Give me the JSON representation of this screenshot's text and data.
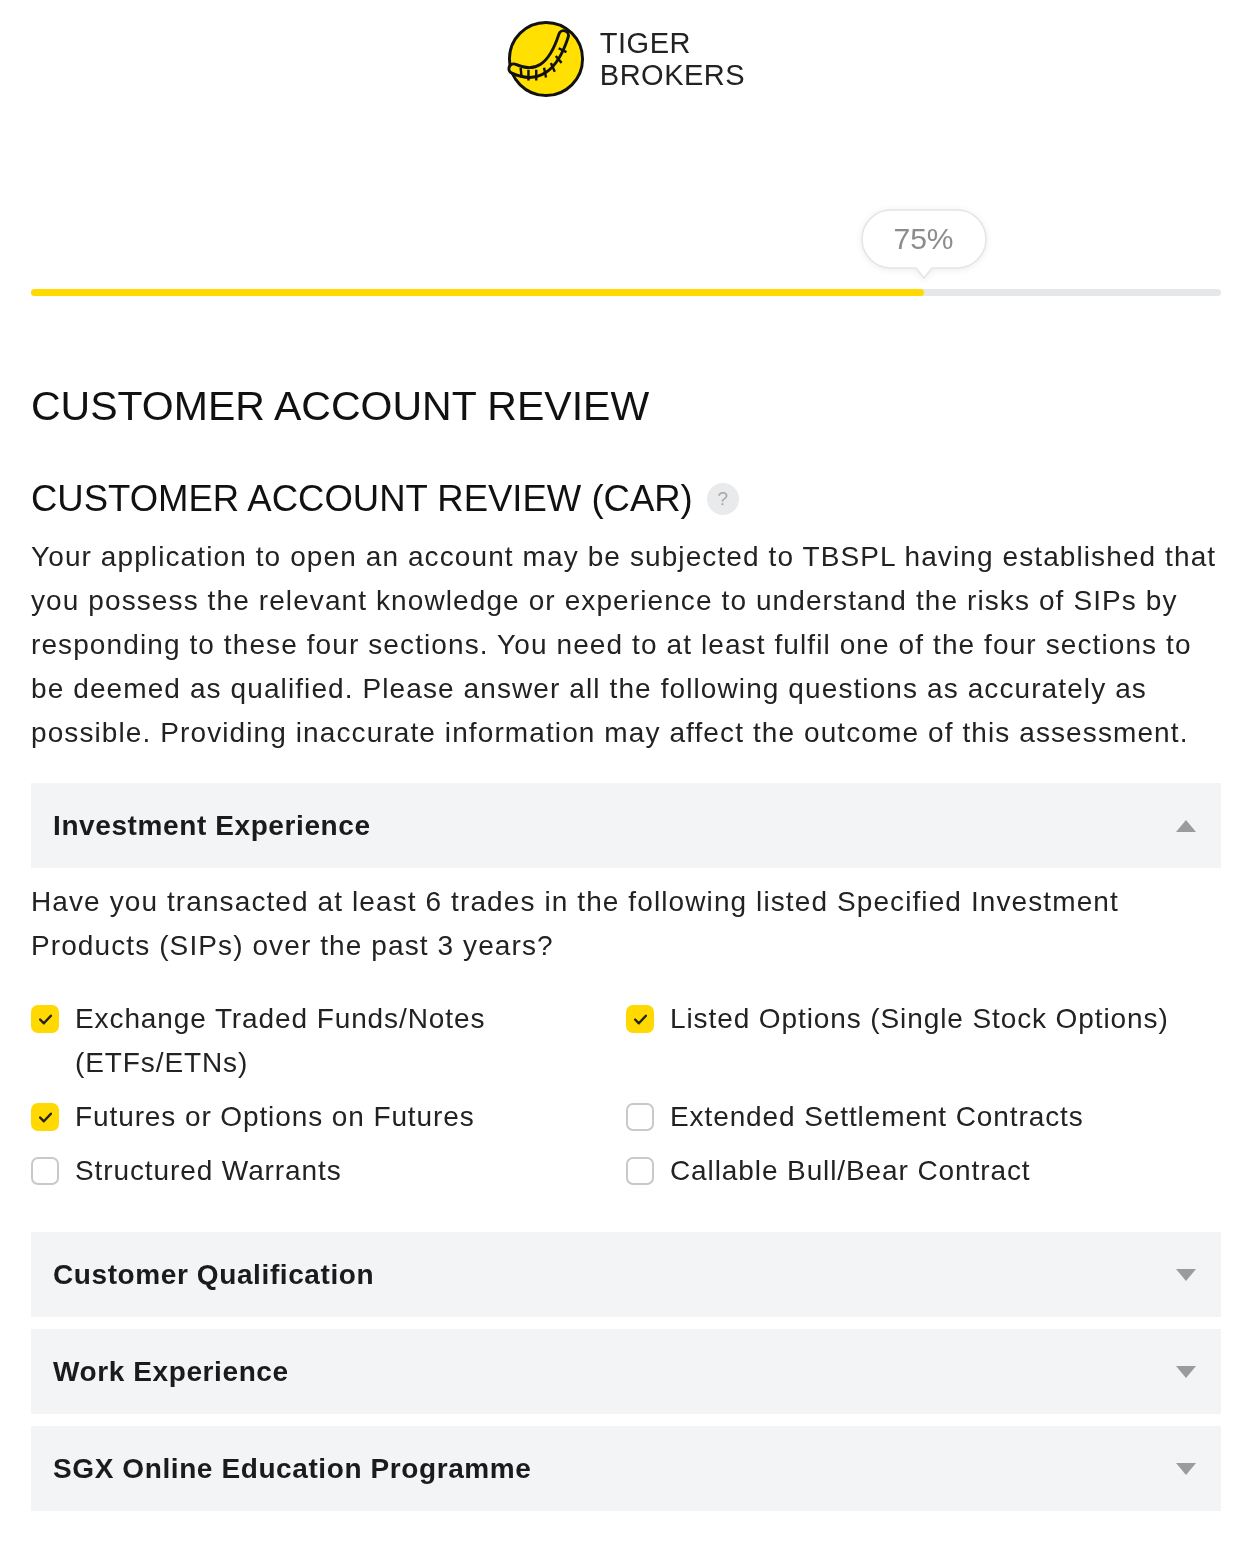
{
  "logo": {
    "line_1": "TIGER",
    "line_2": "BROKERS"
  },
  "progress": {
    "label": "75%",
    "level": 0.75
  },
  "page_title": "CUSTOMER ACCOUNT REVIEW",
  "section": {
    "title": "CUSTOMER ACCOUNT REVIEW (CAR)",
    "help_icon": "?",
    "intro": "Your application to open an account may be subjected to TBSPL having established that you possess the relevant knowledge or experience to understand the risks of SIPs by responding to these four sections. You need to at least fulfil one of the four sections to be deemed as qualified. Please answer all the following questions as accurately as possible. Providing inaccurate information may affect the outcome of this assessment."
  },
  "accordions": [
    {
      "title": "Investment Experience",
      "expanded": true,
      "question": "Have you transacted at least 6 trades in the following listed Specified Investment Products (SIPs) over the past 3 years?",
      "options": [
        {
          "label": "Exchange Traded Funds/Notes (ETFs/ETNs)",
          "checked": true
        },
        {
          "label": "Listed Options (Single Stock Options)",
          "checked": true
        },
        {
          "label": "Futures or Options on Futures",
          "checked": true
        },
        {
          "label": "Extended Settlement Contracts",
          "checked": false
        },
        {
          "label": "Structured Warrants",
          "checked": false
        },
        {
          "label": "Callable Bull/Bear Contract",
          "checked": false
        }
      ]
    },
    {
      "title": "Customer Qualification",
      "expanded": false
    },
    {
      "title": "Work Experience",
      "expanded": false
    },
    {
      "title": "SGX Online Education Programme",
      "expanded": false
    }
  ]
}
